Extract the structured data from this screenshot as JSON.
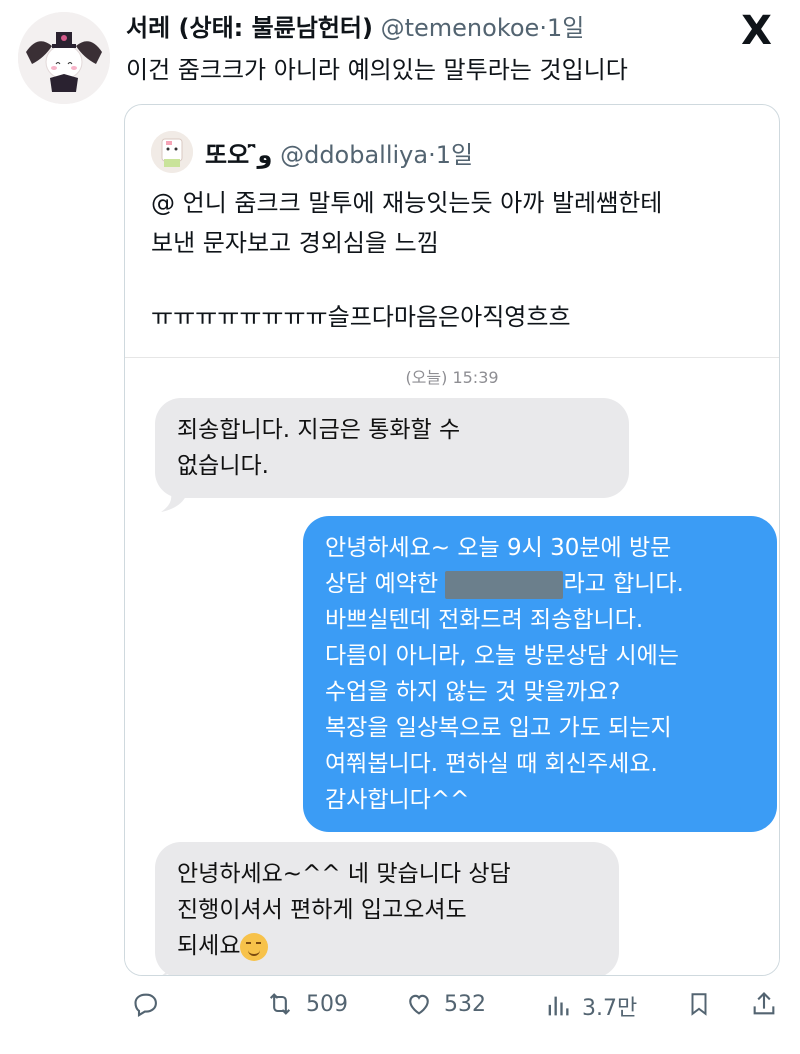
{
  "tweet": {
    "author_name": "서레 (상태: 불륜남헌터)",
    "handle": "@temenokoe",
    "separator": "·",
    "time": "1일",
    "text": "이건 줌크크가 아니라 예의있는 말투라는 것입니다"
  },
  "brand": {
    "logo_text": "X"
  },
  "quote": {
    "author_name": "또오 ̑̈و",
    "handle": "@ddoballiya",
    "separator": "·",
    "time": "1일",
    "lines": [
      "@ 언니 줌크크 말투에 재능잇는듯 아까 발레쌤한테",
      "보낸 문자보고 경외심을 느낌",
      "ㅠㅠㅠㅠㅠㅠㅠㅠ슬프다마음은아직영흐흐"
    ]
  },
  "screenshot": {
    "timestamp_label": "(오늘) 15:39",
    "msg1": [
      "죄송합니다. 지금은 통화할 수",
      "없습니다."
    ],
    "msg2": {
      "line1": "안녕하세요~ 오늘 9시 30분에 방문",
      "line2_before": "상담 예약한",
      "line2_after": "라고 합니다.",
      "rest": [
        "바쁘실텐데 전화드려 죄송합니다.",
        "다름이 아니라, 오늘 방문상담 시에는",
        "수업을 하지 않는 것 맞을까요?",
        "복장을 일상복으로 입고 가도 되는지",
        "여쭤봅니다. 편하실 때 회신주세요.",
        "감사합니다^^"
      ]
    },
    "msg3": [
      "안녕하세요~^^ 네 맞습니다 상담",
      "진행이셔서 편하게 입고오셔도",
      "되세요"
    ]
  },
  "actions": {
    "retweets": "509",
    "likes": "532",
    "views": "3.7만"
  },
  "icons": [
    "reply-icon",
    "retweet-icon",
    "like-icon",
    "views-icon",
    "bookmark-icon",
    "share-icon"
  ]
}
